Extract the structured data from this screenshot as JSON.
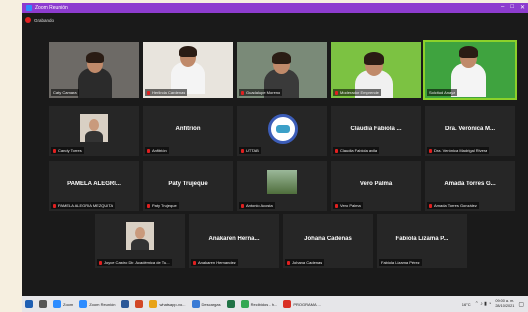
{
  "window": {
    "title": "Zoom Reunión",
    "controls": [
      "–",
      "□",
      "✕"
    ]
  },
  "recording": {
    "label": "Grabando"
  },
  "grid": {
    "row1": [
      {
        "name": "Caty Camara",
        "video": "woman-glasses",
        "muted": false
      },
      {
        "name": "Herlinda Cardenas",
        "video": "woman-uniform",
        "muted": true
      },
      {
        "name": "Guadalupe Moreno",
        "video": "man-glasses",
        "muted": true
      },
      {
        "name": "Moderador Emprende",
        "video": "man-green",
        "muted": true
      },
      {
        "name": "Solcitud Anaya",
        "video": "man-shirt",
        "muted": false,
        "active": true
      }
    ],
    "row2": [
      {
        "name": "Candy Torres",
        "big": "",
        "video": "woman-photo",
        "muted": true
      },
      {
        "name": "Anfitrión",
        "big": "Anfitrión",
        "muted": true
      },
      {
        "name": "UTTAB",
        "big": "",
        "video": "logo",
        "muted": true
      },
      {
        "name": "Claudia Fabiola avila",
        "big": "Claudia Fabiola ...",
        "muted": true
      },
      {
        "name": "Dra. Verónica Madrigal Rivera",
        "big": "Dra. Verónica M...",
        "muted": true
      }
    ],
    "row3": [
      {
        "name": "PAMELA ALEGRIA MEZQUITA",
        "big": "PAMELA ALEGRI...",
        "muted": true
      },
      {
        "name": "Paty Trujeque",
        "big": "Paty Trujeque",
        "muted": true
      },
      {
        "name": "Antonio Acosta",
        "big": "",
        "video": "landscape",
        "muted": true
      },
      {
        "name": "Vero Palma",
        "big": "Vero Palma",
        "muted": true
      },
      {
        "name": "Amada Torres González",
        "big": "Amada Torres G...",
        "muted": true
      }
    ],
    "row4": [
      {
        "name": "Joyce Castro Dir. Académica de Tu...",
        "big": "",
        "video": "woman-photo2",
        "muted": true
      },
      {
        "name": "Anakaren Hernandez",
        "big": "Anakaren Herna...",
        "muted": true
      },
      {
        "name": "Johana Cadenas",
        "big": "Johana Cadenas",
        "muted": true
      },
      {
        "name": "Fabiola Lizama Pérez",
        "big": "Fabiola Lizama P...",
        "muted": false
      }
    ]
  },
  "taskbar": {
    "items": [
      {
        "label": "",
        "icon": "windows-icon",
        "color": "#1e5fb3"
      },
      {
        "label": "",
        "icon": "task-view-icon",
        "color": "#555555"
      },
      {
        "label": "Zoom",
        "icon": "zoom-icon",
        "color": "#2d8cff"
      },
      {
        "label": "Zoom Reunión",
        "icon": "zoom-meeting-icon",
        "color": "#2d8cff"
      },
      {
        "label": "",
        "icon": "word-icon",
        "color": "#2b5797"
      },
      {
        "label": "",
        "icon": "powerpoint-icon",
        "color": "#d24726"
      },
      {
        "label": "whatsapp-vo...",
        "icon": "chrome-icon",
        "color": "#e8a317"
      },
      {
        "label": "Descargas",
        "icon": "download-icon",
        "color": "#3a7bd5"
      },
      {
        "label": "",
        "icon": "excel-icon",
        "color": "#217346"
      },
      {
        "label": "Recibidos - h...",
        "icon": "chrome-icon-2",
        "color": "#34a853"
      },
      {
        "label": "PROGRAMA ...",
        "icon": "pdf-icon",
        "color": "#d93025"
      }
    ],
    "tray": {
      "weather": "16°C",
      "time": "09:00 a. m.",
      "date": "28/10/2021"
    }
  },
  "colors": {
    "titlebar": "#8d3ccf",
    "active_border": "#8cd12a",
    "muted_mic": "#e02020"
  }
}
